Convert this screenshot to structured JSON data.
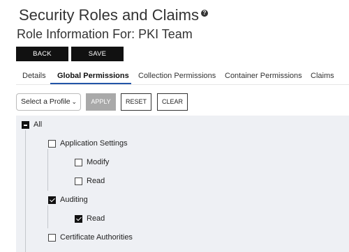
{
  "header": {
    "title": "Security Roles and Claims",
    "help_icon": "?",
    "subtitle": "Role Information For: PKI Team"
  },
  "actions": {
    "back_label": "BACK",
    "save_label": "SAVE"
  },
  "tabs": [
    {
      "label": "Details",
      "active": false
    },
    {
      "label": "Global Permissions",
      "active": true
    },
    {
      "label": "Collection Permissions",
      "active": false
    },
    {
      "label": "Container Permissions",
      "active": false
    },
    {
      "label": "Claims",
      "active": false
    }
  ],
  "toolbar": {
    "profile_select_value": "Select a Profile",
    "apply_label": "APPLY",
    "reset_label": "RESET",
    "clear_label": "CLEAR"
  },
  "tree": {
    "root": {
      "label": "All",
      "state": "indeterminate"
    },
    "nodes": [
      {
        "label": "Application Settings",
        "state": "unchecked",
        "level": 1
      },
      {
        "label": "Modify",
        "state": "unchecked",
        "level": 2
      },
      {
        "label": "Read",
        "state": "unchecked",
        "level": 2
      },
      {
        "label": "Auditing",
        "state": "checked",
        "level": 1
      },
      {
        "label": "Read",
        "state": "checked",
        "level": 2
      },
      {
        "label": "Certificate Authorities",
        "state": "unchecked",
        "level": 1
      }
    ]
  },
  "colors": {
    "accent": "#2255a8",
    "dark_button": "#111111",
    "disabled_button": "#a9a9a9",
    "tree_background": "#eef0f4"
  }
}
